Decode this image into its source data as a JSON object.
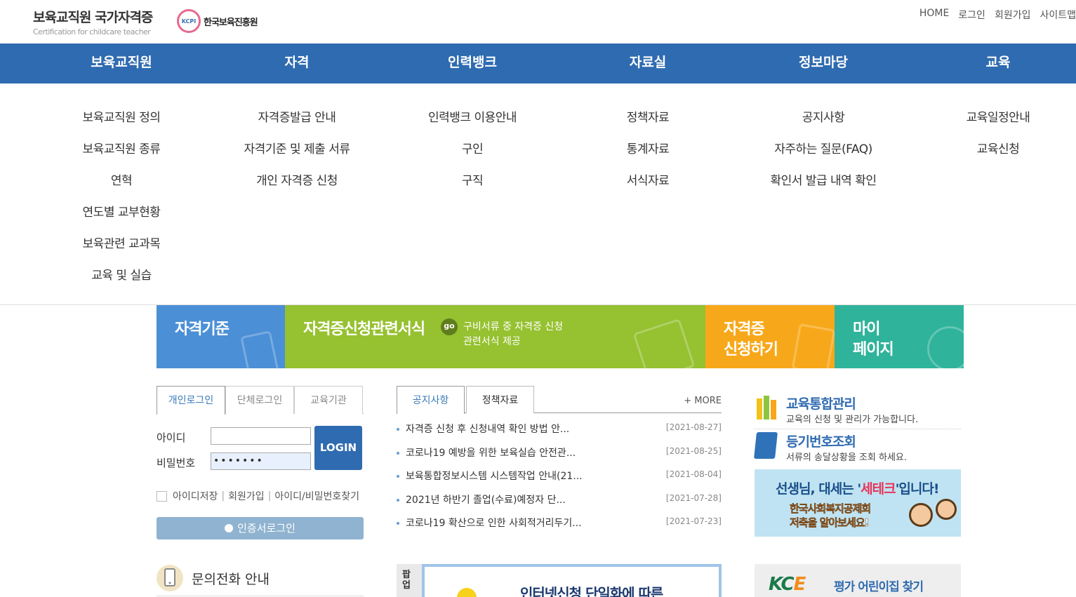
{
  "header": {
    "title": "보육교직원 국가자격증",
    "subtitle": "Certification for childcare teacher",
    "org_mark": "KCPI",
    "org_name": "한국보육진흥원",
    "util": [
      "HOME",
      "로그인",
      "회원가입",
      "사이트맵"
    ]
  },
  "gnb": [
    "보육교직원",
    "자격",
    "인력뱅크",
    "자료실",
    "정보마당",
    "교육"
  ],
  "submenu": [
    [
      "보육교직원 정의",
      "보육교직원 종류",
      "연혁",
      "연도별 교부현황",
      "보육관련 교과목",
      "교육 및 실습"
    ],
    [
      "자격증발급 안내",
      "자격기준 및 제출 서류",
      "개인 자격증 신청"
    ],
    [
      "인력뱅크 이용안내",
      "구인",
      "구직"
    ],
    [
      "정책자료",
      "통계자료",
      "서식자료"
    ],
    [
      "공지사항",
      "자주하는 질문(FAQ)",
      "확인서 발급 내역 확인"
    ],
    [
      "교육일정안내",
      "교육신청"
    ]
  ],
  "banners": {
    "b1": "자격기준",
    "b2": "자격증신청관련서식",
    "b2_go": "go",
    "b2_desc1": "구비서류 중 자격증 신청",
    "b2_desc2": "관련서식 제공",
    "b3_l1": "자격증",
    "b3_l2": "신청하기",
    "b4_l1": "마이",
    "b4_l2": "페이지"
  },
  "login": {
    "tabs": [
      "개인로그인",
      "단체로그인",
      "교육기관"
    ],
    "id_label": "아이디",
    "pw_label": "비밀번호",
    "id_value": "",
    "pw_value": "•••••••",
    "button": "LOGIN",
    "save_id": "아이디저장",
    "join": "회원가입",
    "find": "아이디/비밀번호찾기",
    "sep": "|",
    "cert": "인증서로그인",
    "inquiry": "문의전화 안내"
  },
  "notice": {
    "tabs": [
      "공지사항",
      "정책자료"
    ],
    "more": "+ MORE",
    "items": [
      {
        "title": "자격증 신청 후 신청내역 확인 방법 안...",
        "date": "[2021-08-27]"
      },
      {
        "title": "코로나19 예방을 위한 보육실습 안전관...",
        "date": "[2021-08-25]"
      },
      {
        "title": "보육통합정보시스템 시스템작업 안내(21...",
        "date": "[2021-08-04]"
      },
      {
        "title": "2021년 하반기 졸업(수료)예정자 단...",
        "date": "[2021-07-28]"
      },
      {
        "title": "코로나19 확산으로 인한 사회적거리두기...",
        "date": "[2021-07-23]"
      }
    ]
  },
  "popup": {
    "label": "팝업",
    "title": "인터넷신청 단일화에 따른"
  },
  "right": {
    "edu_title": "교육통합관리",
    "edu_sub": "교육의 신청 및 관리가 가능합니다.",
    "reg_title": "등기번호조회",
    "reg_sub": "서류의 송달상황을 조회 하세요.",
    "ad_pre": "선생님, 대세는 '",
    "ad_em": "세테크",
    "ad_post": "'입니다!",
    "ad_l2": "한국사회복지공제회",
    "ad_l3": "저축을 알아보세요!",
    "kce_k": "KC",
    "kce_e": "E",
    "kce_text": "평가 어린이집 찾기"
  },
  "colors": {
    "primary": "#2f6bb0",
    "banner_blue": "#4b8fd6",
    "banner_green": "#96c130",
    "banner_orange": "#f7a81a",
    "banner_teal": "#2fb39a"
  }
}
